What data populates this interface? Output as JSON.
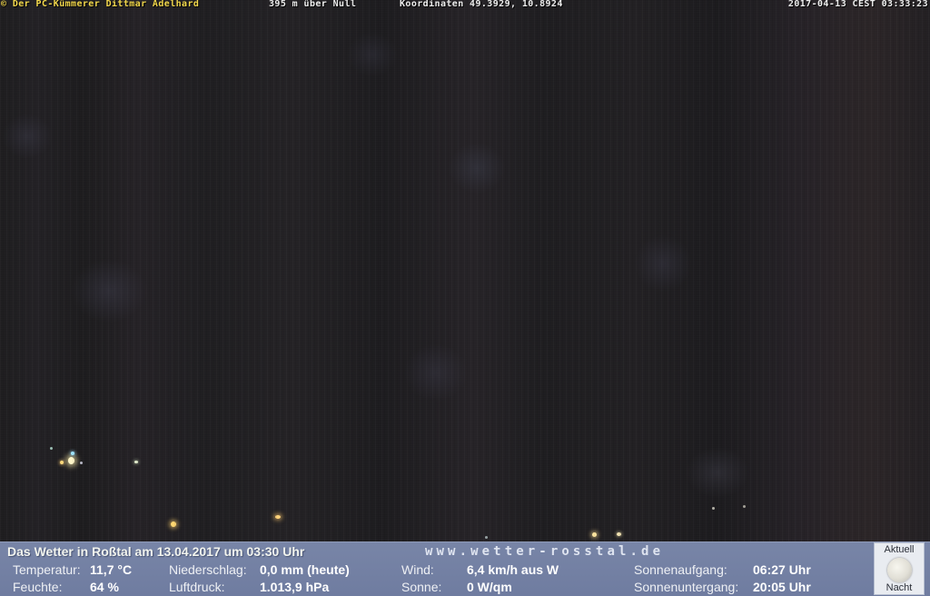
{
  "overlay": {
    "copyright": "© Der PC-Kümmerer Dittmar Adelhard",
    "altitude": "395 m über Null",
    "coordinates": "Koordinaten 49.3929, 10.8924",
    "timestamp": "2017-04-13 CEST 03:33:23"
  },
  "weather": {
    "headline": "Das Wetter in Roßtal am 13.04.2017 um 03:30 Uhr",
    "site": "www.wetter-rosstal.de",
    "temperature": {
      "label": "Temperatur:",
      "value": "11,7 °C"
    },
    "humidity": {
      "label": "Feuchte:",
      "value": "64 %"
    },
    "precipitation": {
      "label": "Niederschlag:",
      "value": "0,0 mm (heute)"
    },
    "pressure": {
      "label": "Luftdruck:",
      "value": "1.013,9 hPa"
    },
    "wind": {
      "label": "Wind:",
      "value": "6,4 km/h aus W"
    },
    "sun": {
      "label": "Sonne:",
      "value": "0 W/qm"
    },
    "sunrise": {
      "label": "Sonnenaufgang:",
      "value": "06:27 Uhr"
    },
    "sunset": {
      "label": "Sonnenuntergang:",
      "value": "20:05 Uhr"
    },
    "moon": {
      "top_caption": "Aktuell",
      "bottom_caption": "Nacht",
      "icon": "moon-icon"
    }
  },
  "colors": {
    "bar_background": "#7482a5",
    "overlay_text": "#f0f0f0",
    "copyright_text": "#f3d84a"
  }
}
